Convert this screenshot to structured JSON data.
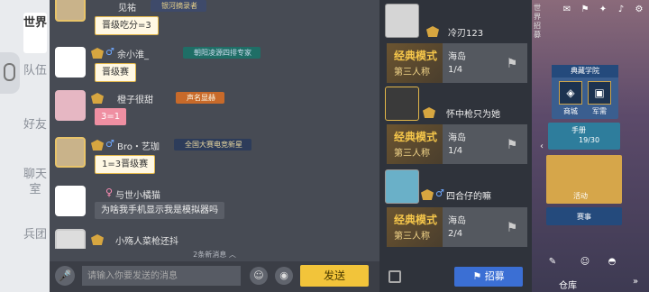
{
  "tabs": [
    {
      "label": "世界",
      "active": true
    },
    {
      "label": "队伍",
      "active": false
    },
    {
      "label": "好友",
      "active": false
    },
    {
      "label": "聊天室",
      "active": false
    },
    {
      "label": "兵团",
      "active": false
    }
  ],
  "chat": {
    "messages": [
      {
        "username": "见祐",
        "gender": "",
        "tag": "银河摘录者",
        "text": "晋级吃分=3"
      },
      {
        "username": "余小淮_",
        "gender": "♂",
        "tag": "朝阳凌源四排专家",
        "text": "晋级赛"
      },
      {
        "username": "橙子很甜",
        "gender": "",
        "tag": "声名显赫",
        "text": "3=1"
      },
      {
        "username": "Bro・艺珈",
        "gender": "♂",
        "tag": "全国大赛电竞新星",
        "text": "1=3晋级赛"
      },
      {
        "username": "与世小橘猫",
        "gender": "♀",
        "tag": "",
        "text": "为啥我手机显示我是模拟器吗"
      },
      {
        "username": "小殇人菜枪还抖",
        "gender": "",
        "tag": "",
        "text": ""
      }
    ],
    "new_messages": "2条新消息",
    "input_placeholder": "请输入你要发送的消息",
    "send_label": "发送"
  },
  "teams": [
    {
      "leader": "冷刃123",
      "gender": "",
      "mode_line1": "经典模式",
      "mode_line2": "第三人称",
      "map": "海岛",
      "count": "1/4"
    },
    {
      "leader": "怀中枪只为她",
      "gender": "",
      "mode_line1": "经典模式",
      "mode_line2": "第三人称",
      "map": "海岛",
      "count": "1/4"
    },
    {
      "leader": "四合仔的嘛",
      "gender": "♂",
      "mode_line1": "经典模式",
      "mode_line2": "第三人称",
      "map": "海岛",
      "count": "2/4"
    }
  ],
  "recruit_label": "招募",
  "game_strip": {
    "world_label": "世界招募",
    "shop_title": "典藏学院",
    "shop_left": "商城",
    "shop_right": "军需",
    "handbook": "手册",
    "handbook_count": "19/30",
    "activity": "活动",
    "event": "赛事",
    "warehouse": "仓库"
  },
  "colors": {
    "send": "#f2c43a",
    "recruit": "#3b6fd4",
    "mode_gold": "#f5c64a"
  }
}
